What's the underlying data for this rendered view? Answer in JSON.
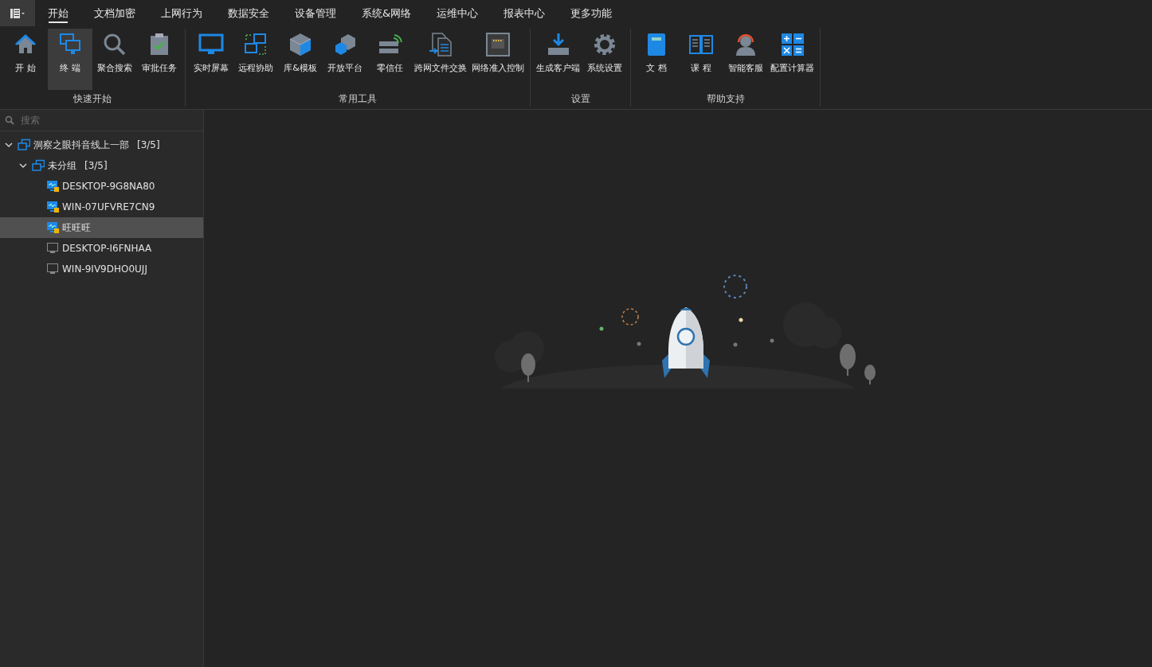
{
  "menu_tabs": [
    {
      "label": "开始",
      "selected": true
    },
    {
      "label": "文档加密",
      "selected": false
    },
    {
      "label": "上网行为",
      "selected": false
    },
    {
      "label": "数据安全",
      "selected": false
    },
    {
      "label": "设备管理",
      "selected": false
    },
    {
      "label": "系统&网络",
      "selected": false
    },
    {
      "label": "运维中心",
      "selected": false
    },
    {
      "label": "报表中心",
      "selected": false
    },
    {
      "label": "更多功能",
      "selected": false
    }
  ],
  "ribbon_groups": [
    {
      "label": "快速开始",
      "items": [
        {
          "kind": "home",
          "label": "开 始",
          "selected": false
        },
        {
          "kind": "terminals",
          "label": "终 端",
          "selected": true
        },
        {
          "kind": "search",
          "label": "聚合搜索",
          "selected": false
        },
        {
          "kind": "clipboard",
          "label": "审批任务",
          "selected": false
        }
      ]
    },
    {
      "label": "常用工具",
      "items": [
        {
          "kind": "monitor",
          "label": "实时屏幕",
          "selected": false
        },
        {
          "kind": "remote",
          "label": "远程协助",
          "selected": false
        },
        {
          "kind": "cube",
          "label": "库&模板",
          "selected": false
        },
        {
          "kind": "hexagons",
          "label": "开放平台",
          "selected": false
        },
        {
          "kind": "server",
          "label": "零信任",
          "selected": false
        },
        {
          "kind": "files",
          "label": "跨网文件交换",
          "selected": false
        },
        {
          "kind": "port",
          "label": "网络准入控制",
          "selected": false
        }
      ]
    },
    {
      "label": "设置",
      "items": [
        {
          "kind": "download",
          "label": "生成客户端",
          "selected": false
        },
        {
          "kind": "gear",
          "label": "系统设置",
          "selected": false
        }
      ]
    },
    {
      "label": "帮助支持",
      "items": [
        {
          "kind": "book",
          "label": "文 档",
          "selected": false
        },
        {
          "kind": "openbook",
          "label": "课 程",
          "selected": false
        },
        {
          "kind": "headset",
          "label": "智能客服",
          "selected": false
        },
        {
          "kind": "calculator",
          "label": "配置计算器",
          "selected": false
        }
      ]
    }
  ],
  "sidebar": {
    "search": {
      "placeholder": "搜索"
    },
    "tree": [
      {
        "kind": "group",
        "label": "洞察之眼抖音线上一部",
        "count": "[3/5]",
        "expanded": true,
        "selected": false,
        "children": [
          {
            "kind": "group",
            "label": "未分组",
            "count": "[3/5]",
            "expanded": true,
            "selected": false,
            "children": [
              {
                "kind": "online",
                "label": "DESKTOP-9G8NA80",
                "selected": false
              },
              {
                "kind": "online",
                "label": "WIN-07UFVRE7CN9",
                "selected": false
              },
              {
                "kind": "online",
                "label": "旺旺旺",
                "selected": true
              },
              {
                "kind": "offline",
                "label": "DESKTOP-I6FNHAA",
                "selected": false
              },
              {
                "kind": "offline",
                "label": "WIN-9IV9DHO0UJJ",
                "selected": false
              }
            ]
          }
        ]
      }
    ]
  }
}
